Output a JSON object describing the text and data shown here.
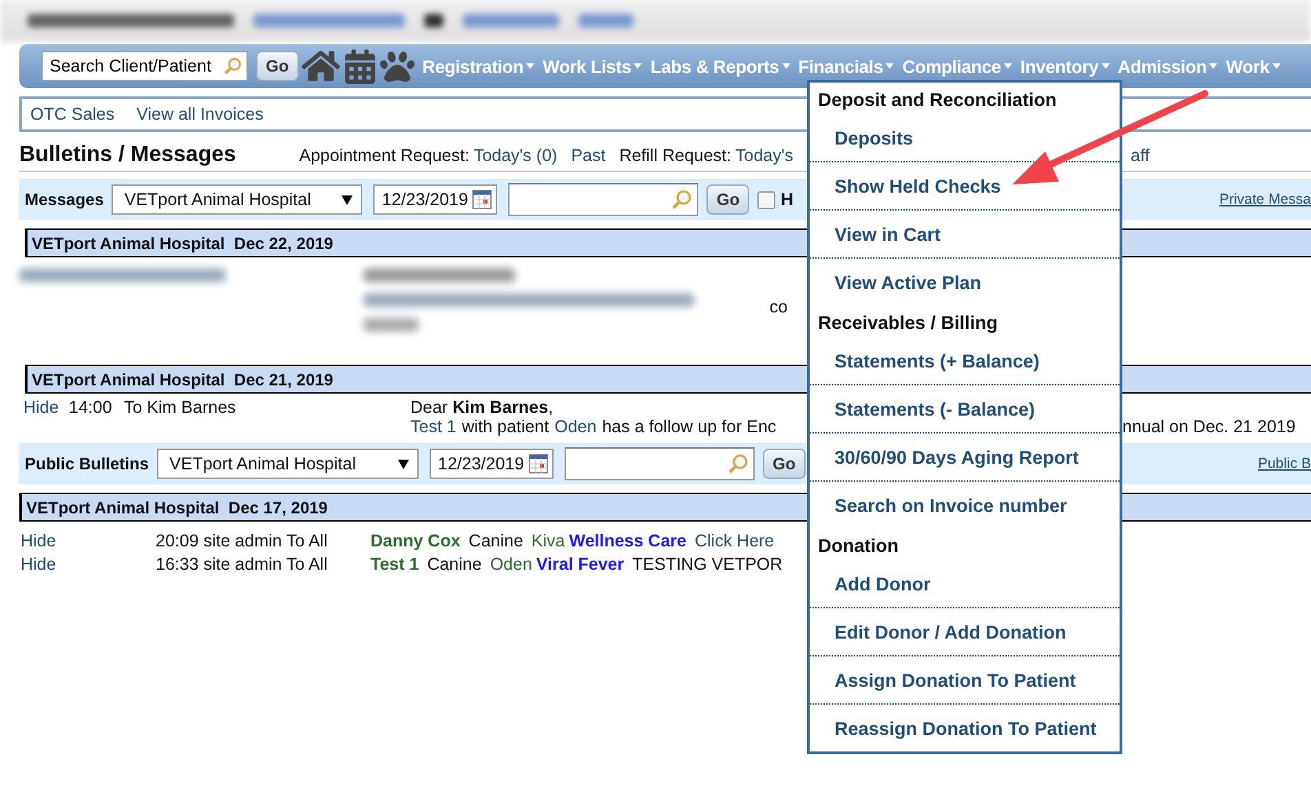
{
  "nav": {
    "search": {
      "placeholder": "Search Client/Patient"
    },
    "go": "Go",
    "menus": [
      "Registration",
      "Work Lists",
      "Labs & Reports",
      "Financials",
      "Compliance",
      "Inventory",
      "Admission",
      "Work"
    ]
  },
  "sub_nav": [
    "OTC Sales",
    "View all Invoices"
  ],
  "page_title": "Bulletins / Messages",
  "requests": [
    {
      "kind": "label",
      "text": "Appointment Request:"
    },
    {
      "kind": "link",
      "text": "Today's (0)"
    },
    {
      "kind": "link",
      "text": "Past"
    },
    {
      "kind": "label",
      "text": "Refill Request:"
    },
    {
      "kind": "link",
      "text": "Today's"
    }
  ],
  "requests_tail": "aff",
  "messages": {
    "label": "Messages",
    "location": "VETport Animal Hospital",
    "date": "12/23/2019",
    "go": "Go",
    "checkbox": {
      "label": "H",
      "checked": false
    },
    "link": "Private Messa",
    "groups": [
      {
        "header": "VETport Animal Hospital  Dec 22, 2019",
        "rows": [
          {
            "kind": "redacted",
            "tail": "co"
          }
        ]
      },
      {
        "header": "VETport Animal Hospital  Dec 21, 2019",
        "rows": [
          {
            "kind": "message",
            "action": "Hide",
            "time": "14:00",
            "to": "To Kim Barnes",
            "greeting": "Dear **Kim Barnes**,",
            "body": [
              {
                "kind": "link",
                "text": "Test 1"
              },
              {
                "kind": "text",
                "text": "with patient"
              },
              {
                "kind": "link",
                "text": "Oden"
              },
              {
                "kind": "text",
                "text": "has a follow up for Enc"
              }
            ],
            "body_tail": "nnual on Dec. 21 2019"
          }
        ]
      }
    ]
  },
  "bulletins": {
    "label": "Public Bulletins",
    "location": "VETport Animal Hospital",
    "date": "12/23/2019",
    "go": "Go",
    "link": "Public B",
    "groups": [
      {
        "header": "VETport Animal Hospital  Dec 17, 2019",
        "rows": [
          {
            "action": "Hide",
            "time": "20:09 site admin To All",
            "client": "Danny Cox",
            "species": "Canine",
            "patient": "Kiva",
            "topic": "Wellness Care",
            "extra": {
              "kind": "link",
              "text": "Click Here"
            }
          },
          {
            "action": "Hide",
            "time": "16:33 site admin To All",
            "client": "Test 1",
            "species": "Canine",
            "patient": "Oden",
            "topic": "Viral Fever",
            "extra": {
              "kind": "text",
              "text": "TESTING VETPOR"
            }
          }
        ]
      }
    ]
  },
  "financials_menu": [
    {
      "kind": "header",
      "label": "Deposit and Reconciliation"
    },
    {
      "kind": "item",
      "label": "Deposits"
    },
    {
      "kind": "item",
      "label": "Show Held Checks"
    },
    {
      "kind": "item",
      "label": "View in Cart"
    },
    {
      "kind": "item",
      "label": "View Active Plan"
    },
    {
      "kind": "header",
      "label": "Receivables / Billing"
    },
    {
      "kind": "item",
      "label": "Statements (+ Balance)"
    },
    {
      "kind": "item",
      "label": "Statements (- Balance)"
    },
    {
      "kind": "item",
      "label": "30/60/90 Days Aging Report"
    },
    {
      "kind": "item",
      "label": "Search on Invoice number"
    },
    {
      "kind": "header",
      "label": "Donation"
    },
    {
      "kind": "item",
      "label": "Add Donor"
    },
    {
      "kind": "item",
      "label": "Edit Donor / Add Donation"
    },
    {
      "kind": "item",
      "label": "Assign Donation To Patient"
    },
    {
      "kind": "item",
      "label": "Reassign Donation To Patient"
    }
  ]
}
